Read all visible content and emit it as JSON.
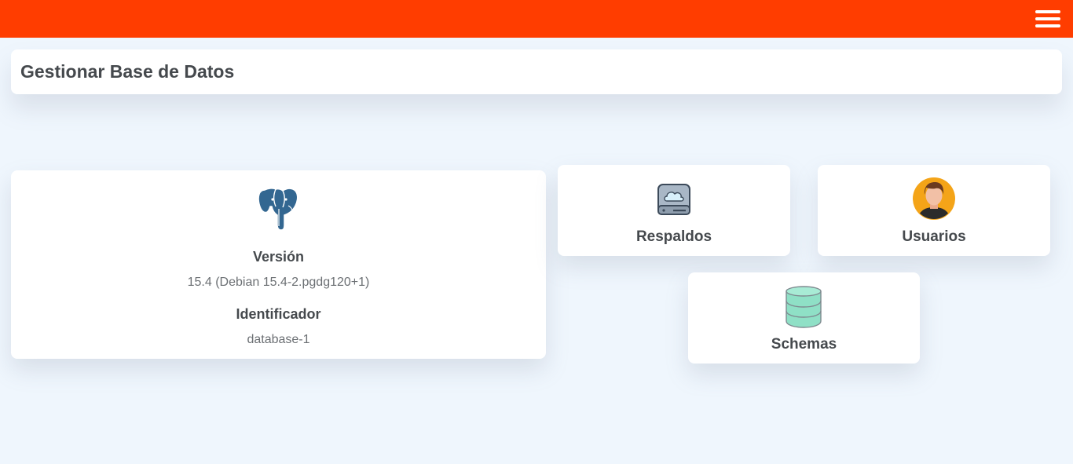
{
  "header": {
    "menu_icon": "hamburger-menu-icon",
    "accent_color": "#ff3d00"
  },
  "page": {
    "title": "Gestionar Base de Datos"
  },
  "database_info": {
    "icon": "postgresql-elephant-icon",
    "version_label": "Versión",
    "version_value": "15.4 (Debian 15.4-2.pgdg120+1)",
    "identifier_label": "Identificador",
    "identifier_value": "database-1"
  },
  "actions": {
    "backups": {
      "label": "Respaldos",
      "icon": "cloud-storage-drive-icon"
    },
    "users": {
      "label": "Usuarios",
      "icon": "user-avatar-icon"
    },
    "schemas": {
      "label": "Schemas",
      "icon": "database-stack-icon"
    }
  }
}
